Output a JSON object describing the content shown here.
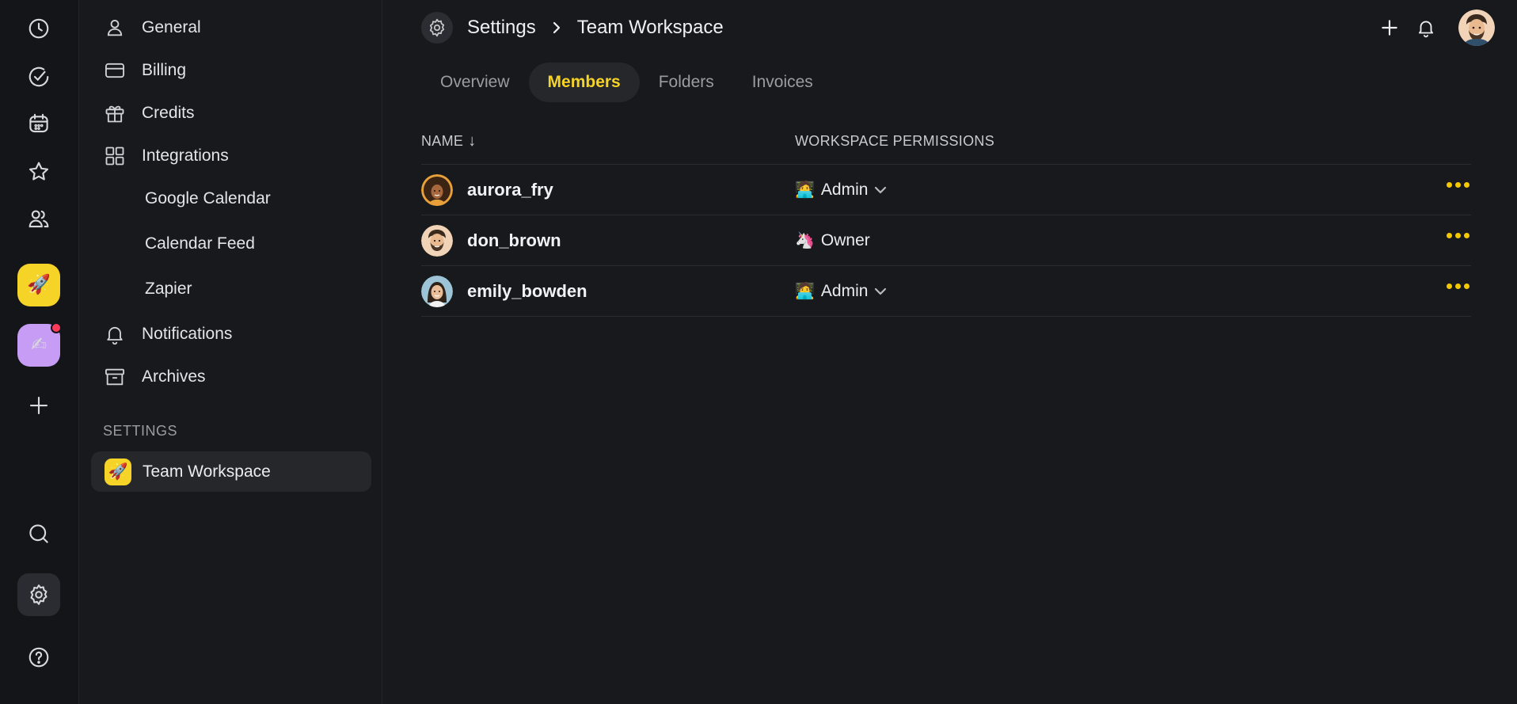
{
  "rail": {
    "items": [
      {
        "icon": "clock-icon"
      },
      {
        "icon": "check-circle-icon"
      },
      {
        "icon": "calendar-icon"
      },
      {
        "icon": "star-icon"
      },
      {
        "icon": "users-icon"
      }
    ],
    "apps": [
      {
        "icon": "rocket-emoji",
        "glyph": "🚀",
        "color": "#f5d327"
      },
      {
        "icon": "writing-hand-emoji",
        "glyph": "✍",
        "color": "#c79cf4",
        "has_notification": true
      }
    ]
  },
  "sidebar": {
    "items": [
      {
        "label": "General",
        "icon": "person-icon"
      },
      {
        "label": "Billing",
        "icon": "credit-card-icon"
      },
      {
        "label": "Credits",
        "icon": "gift-icon"
      },
      {
        "label": "Integrations",
        "icon": "grid-icon"
      }
    ],
    "integrations": [
      "Google Calendar",
      "Calendar Feed",
      "Zapier"
    ],
    "bottom_items": [
      {
        "label": "Notifications",
        "icon": "bell-icon"
      },
      {
        "label": "Archives",
        "icon": "archive-icon"
      }
    ],
    "section_label": "SETTINGS",
    "workspace": {
      "label": "Team Workspace",
      "glyph": "🚀"
    }
  },
  "header": {
    "breadcrumb": [
      "Settings",
      "Team Workspace"
    ]
  },
  "tabs": [
    {
      "label": "Overview",
      "active": false
    },
    {
      "label": "Members",
      "active": true
    },
    {
      "label": "Folders",
      "active": false
    },
    {
      "label": "Invoices",
      "active": false
    }
  ],
  "table": {
    "columns": {
      "name": "NAME",
      "sort_arrow": "↓",
      "permissions": "WORKSPACE PERMISSIONS"
    },
    "rows": [
      {
        "username": "aurora_fry",
        "role": "Admin",
        "role_glyph": "🧑‍💻",
        "editable": true
      },
      {
        "username": "don_brown",
        "role": "Owner",
        "role_glyph": "🦄",
        "editable": false
      },
      {
        "username": "emily_bowden",
        "role": "Admin",
        "role_glyph": "🧑‍💻",
        "editable": true
      }
    ]
  },
  "colors": {
    "accent": "#f5d327",
    "background": "#18191c",
    "notification": "#ff3b5c"
  }
}
